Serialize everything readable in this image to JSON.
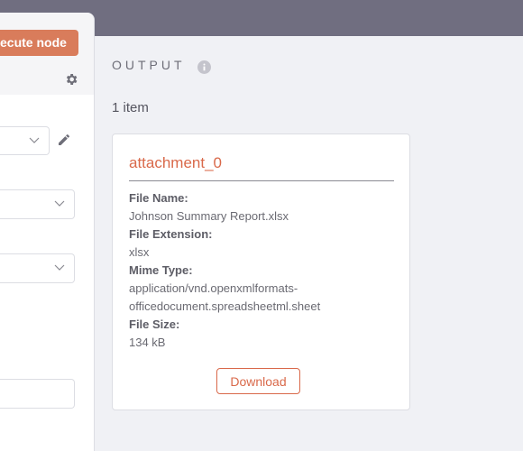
{
  "left_panel": {
    "execute_label": "ecute node"
  },
  "output": {
    "title": "OUTPUT",
    "item_count": "1 item",
    "card": {
      "title": "attachment_0",
      "fields": [
        {
          "label": "File Name:",
          "value": "Johnson Summary Report.xlsx"
        },
        {
          "label": "File Extension:",
          "value": "xlsx"
        },
        {
          "label": "Mime Type:",
          "value": "application/vnd.openxmlformats-officedocument.spreadsheetml.sheet"
        },
        {
          "label": "File Size:",
          "value": "134 kB"
        }
      ],
      "download_label": "Download"
    }
  },
  "colors": {
    "accent": "#d9694a",
    "button": "#d97c5b",
    "topbar": "#706e80"
  }
}
